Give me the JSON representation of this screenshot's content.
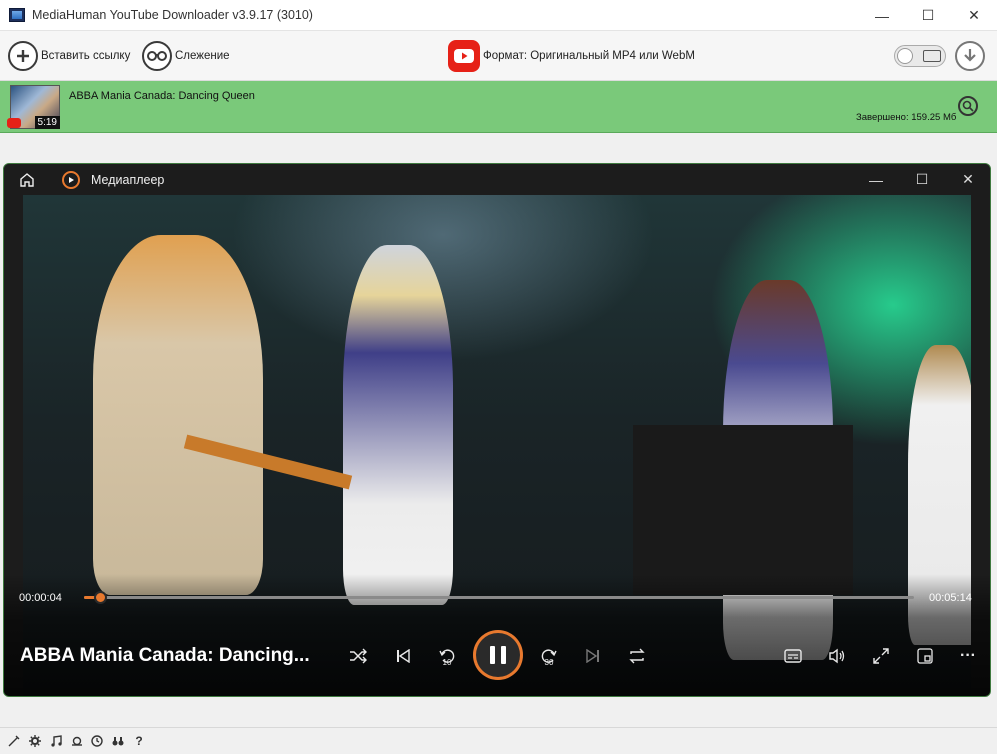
{
  "app": {
    "title": "MediaHuman YouTube Downloader v3.9.17 (3010)",
    "window_controls": {
      "minimize": "—",
      "maximize": "☐",
      "close": "✕"
    }
  },
  "toolbar": {
    "paste_label": "Вставить ссылку",
    "watch_label": "Слежение",
    "format_label": "Формат: Оригинальный MP4 или WebM"
  },
  "download": {
    "title": "ABBA Mania Canada:  Dancing Queen",
    "duration": "5:19",
    "status": "Завершено: 159.25 Мб",
    "colors": {
      "row_bg": "#7ac97a"
    }
  },
  "player": {
    "title": "Медиаплеер",
    "current_time": "00:00:04",
    "total_time": "00:05:14",
    "progress_fraction": 0.013,
    "now_playing": "ABBA Mania Canada:  Dancing...",
    "skip_back": "10",
    "skip_forward": "30",
    "more": "···",
    "colors": {
      "accent": "#e8792e"
    }
  },
  "icons": {
    "app": "video-file-icon",
    "paste": "plus-circle-icon",
    "watch": "binoculars-icon",
    "youtube": "youtube-icon",
    "film": "film-icon",
    "download": "download-arrow-icon",
    "search": "search-icon",
    "home": "home-icon",
    "player-logo": "play-circle-icon",
    "shuffle": "shuffle-icon",
    "previous": "previous-track-icon",
    "next": "next-track-icon",
    "pause": "pause-icon",
    "repeat": "repeat-icon",
    "subtitles": "subtitles-icon",
    "volume": "volume-icon",
    "fullscreen": "fullscreen-icon",
    "mini-player": "mini-player-icon"
  },
  "bottom_bar": {
    "help": "?"
  }
}
